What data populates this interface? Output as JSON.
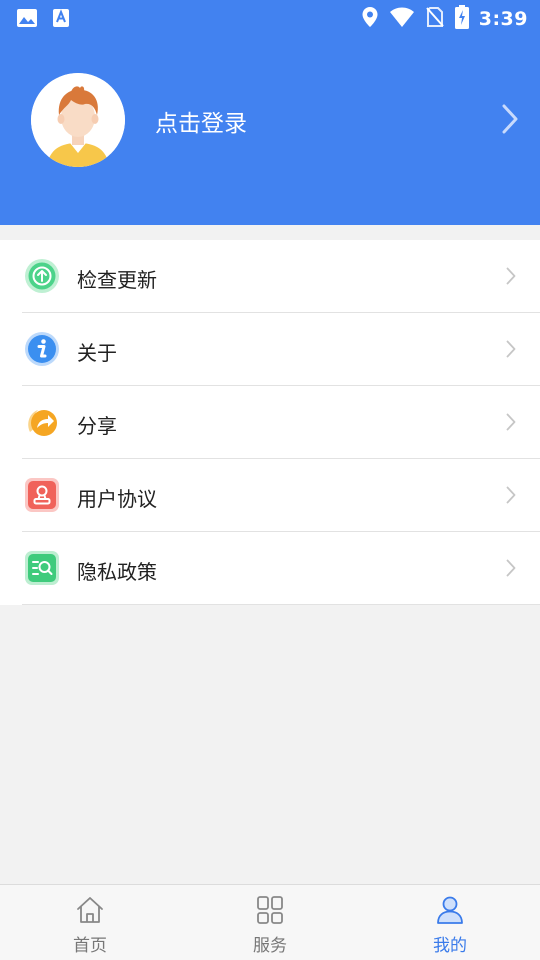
{
  "status_bar": {
    "time": "3:39",
    "left_icons": [
      "image-icon",
      "text-a-icon"
    ],
    "right_icons": [
      "location-icon",
      "wifi-icon",
      "no-sim-icon",
      "battery-charging-icon"
    ]
  },
  "profile": {
    "login_label": "点击登录",
    "avatar_icon": "avatar-boy-icon"
  },
  "menu": {
    "items": [
      {
        "label": "检查更新",
        "icon": "update-icon",
        "color": "#4cd38a"
      },
      {
        "label": "关于",
        "icon": "info-icon",
        "color": "#3b8ff0"
      },
      {
        "label": "分享",
        "icon": "share-icon",
        "color": "#f5a623"
      },
      {
        "label": "用户协议",
        "icon": "agreement-icon",
        "color": "#f0625a"
      },
      {
        "label": "隐私政策",
        "icon": "privacy-icon",
        "color": "#3fcb7c"
      }
    ]
  },
  "tabbar": {
    "tabs": [
      {
        "label": "首页",
        "icon": "home-icon",
        "active": false
      },
      {
        "label": "服务",
        "icon": "grid-icon",
        "active": false
      },
      {
        "label": "我的",
        "icon": "user-icon",
        "active": true
      }
    ]
  },
  "colors": {
    "primary": "#4282f0",
    "active_tab": "#3a7bea",
    "inactive_tab": "#777777",
    "background": "#f2f2f2"
  }
}
